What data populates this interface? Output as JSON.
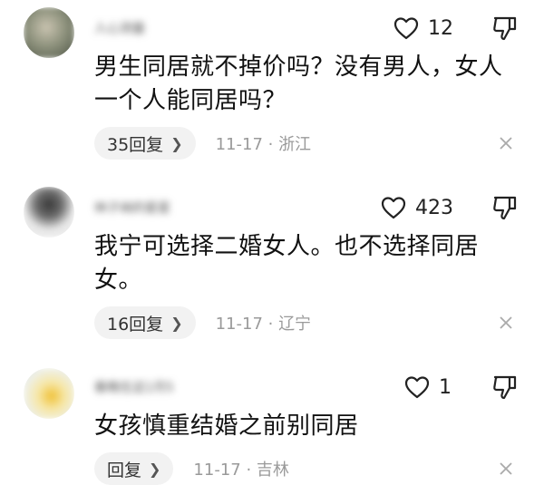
{
  "comments": [
    {
      "username": "人心测量",
      "likes": "12",
      "content": "男生同居就不掉价吗？没有男人，女人一个人能同居吗？",
      "reply_label": "35回复",
      "timestamp": "11-17 · 浙江",
      "avatar_color": "#8a8f7a"
    },
    {
      "username": "林子纳的星星",
      "likes": "423",
      "content": "我宁可选择二婚女人。也不选择同居女。",
      "reply_label": "16回复",
      "timestamp": "11-17 · 辽宁",
      "avatar_color": "#d9d9d9"
    },
    {
      "username": "春晚在这1月5",
      "likes": "1",
      "content": "女孩慎重结婚之前别同居",
      "reply_label": "回复",
      "timestamp": "11-17 · 吉林",
      "avatar_color": "#e8d28a"
    }
  ],
  "icons": {
    "like": "heart-outline-icon",
    "dislike": "thumbs-down-icon",
    "chevron": "chevron-right-icon",
    "close": "close-icon"
  }
}
